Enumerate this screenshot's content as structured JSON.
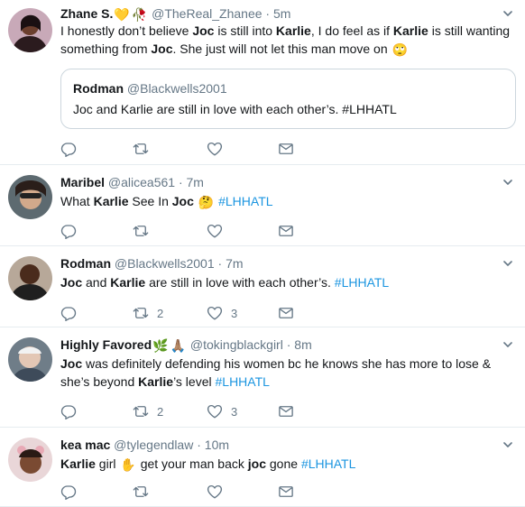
{
  "tweets": [
    {
      "name": "Zhane S.",
      "emojis": [
        "💛",
        "🥀"
      ],
      "handle": "@TheReal_Zhanee",
      "time": "5m",
      "text_parts": [
        {
          "t": "I honestly don’t believe ",
          "b": false
        },
        {
          "t": "Joc",
          "b": true
        },
        {
          "t": " is still into ",
          "b": false
        },
        {
          "t": "Karlie",
          "b": true
        },
        {
          "t": ", I do feel as if ",
          "b": false
        },
        {
          "t": "Karlie",
          "b": true
        },
        {
          "t": " is still wanting something from ",
          "b": false
        },
        {
          "t": "Joc",
          "b": true
        },
        {
          "t": ". She just will not let this man move on ",
          "b": false
        }
      ],
      "trailing_emoji": "🙄",
      "quote": {
        "name": "Rodman",
        "handle": "@Blackwells2001",
        "text": "Joc and Karlie are still in love with each other’s.  #LHHATL"
      },
      "retweets": "",
      "likes": ""
    },
    {
      "name": "Maribel",
      "handle": "@alicea561",
      "time": "7m",
      "text_parts": [
        {
          "t": "What ",
          "b": false
        },
        {
          "t": "Karlie",
          "b": true
        },
        {
          "t": " See In ",
          "b": false
        },
        {
          "t": "Joc",
          "b": true
        }
      ],
      "mid_emoji": "🤔",
      "hashtag": "#LHHATL",
      "retweets": "",
      "likes": ""
    },
    {
      "name": "Rodman",
      "handle": "@Blackwells2001",
      "time": "7m",
      "text_parts": [
        {
          "t": "Joc",
          "b": true
        },
        {
          "t": " and ",
          "b": false
        },
        {
          "t": "Karlie",
          "b": true
        },
        {
          "t": " are still in love with each other’s.  ",
          "b": false
        }
      ],
      "hashtag": "#LHHATL",
      "retweets": "2",
      "likes": "3"
    },
    {
      "name": "Highly Favored",
      "emojis": [
        "🌿",
        "🙏🏽"
      ],
      "handle": "@tokingblackgirl",
      "time": "8m",
      "line1_parts": [
        {
          "t": "Joc",
          "b": true
        },
        {
          "t": " was definitely defending his women bc he knows she has more to lose &",
          "b": false
        }
      ],
      "line2_parts": [
        {
          "t": "she’s beyond ",
          "b": false
        },
        {
          "t": "Karlie",
          "b": true
        },
        {
          "t": "’s level ",
          "b": false
        }
      ],
      "hashtag": "#LHHATL",
      "retweets": "2",
      "likes": "3"
    },
    {
      "name": "kea mac",
      "handle": "@tylegendlaw",
      "time": "10m",
      "text_parts": [
        {
          "t": "Karlie",
          "b": true
        },
        {
          "t": " girl ",
          "b": false
        }
      ],
      "mid_emoji": "✋",
      "text_parts2": [
        {
          "t": " get your man back ",
          "b": false
        },
        {
          "t": "joc",
          "b": true
        },
        {
          "t": " gone ",
          "b": false
        }
      ],
      "hashtag": "#LHHATL",
      "retweets": "",
      "likes": ""
    }
  ],
  "icons": {
    "reply": "reply-icon",
    "retweet": "retweet-icon",
    "like": "heart-icon",
    "dm": "message-icon",
    "caret": "chevron-down-icon"
  },
  "colors": {
    "text": "#14171a",
    "muted": "#657786",
    "link": "#1b95e0",
    "border": "#e6ecf0",
    "icon": "#657786"
  }
}
